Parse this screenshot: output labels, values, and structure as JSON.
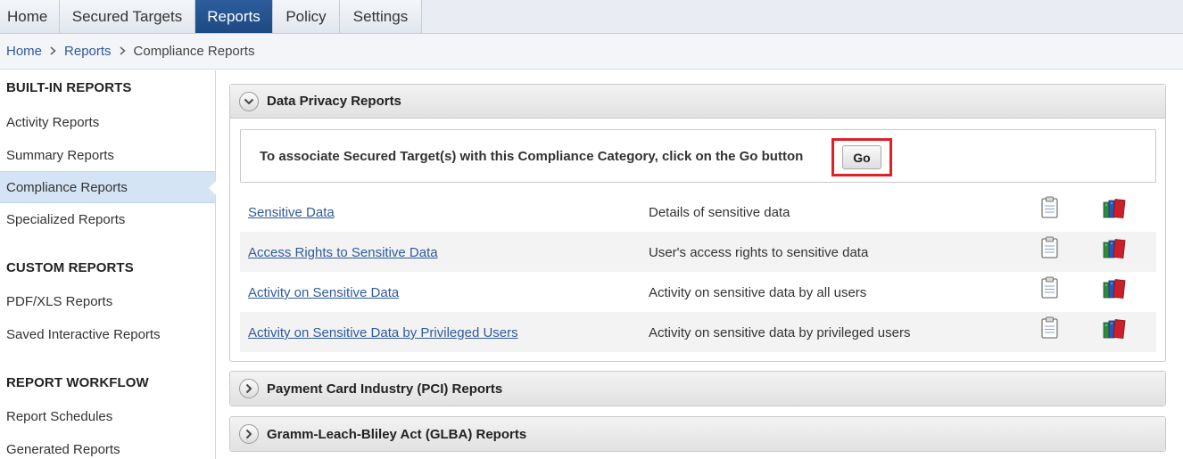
{
  "topnav": {
    "tabs": [
      {
        "label": "Home"
      },
      {
        "label": "Secured Targets"
      },
      {
        "label": "Reports"
      },
      {
        "label": "Policy"
      },
      {
        "label": "Settings"
      }
    ],
    "active_tab": "Reports"
  },
  "breadcrumb": {
    "items": [
      "Home",
      "Reports"
    ],
    "current": "Compliance Reports"
  },
  "sidebar": {
    "sections": [
      {
        "heading": "BUILT-IN REPORTS",
        "items": [
          "Activity Reports",
          "Summary Reports",
          "Compliance Reports",
          "Specialized Reports"
        ]
      },
      {
        "heading": "CUSTOM REPORTS",
        "items": [
          "PDF/XLS Reports",
          "Saved Interactive Reports"
        ]
      },
      {
        "heading": "REPORT WORKFLOW",
        "items": [
          "Report Schedules",
          "Generated Reports"
        ]
      }
    ],
    "active_item": "Compliance Reports"
  },
  "panels": [
    {
      "title": "Data Privacy Reports",
      "expanded": true,
      "assoc_text": "To associate Secured Target(s) with this Compliance Category, click on the Go button",
      "go_label": "Go",
      "reports": [
        {
          "name": "Sensitive Data",
          "desc": "Details of sensitive data"
        },
        {
          "name": "Access Rights to Sensitive Data",
          "desc": "User's access rights to sensitive data"
        },
        {
          "name": "Activity on Sensitive Data",
          "desc": "Activity on sensitive data by all users"
        },
        {
          "name": "Activity on Sensitive Data by Privileged Users",
          "desc": "Activity on sensitive data by privileged users"
        }
      ]
    },
    {
      "title": "Payment Card Industry (PCI) Reports",
      "expanded": false
    },
    {
      "title": "Gramm-Leach-Bliley Act (GLBA) Reports",
      "expanded": false
    }
  ],
  "icons": {
    "report_icon": "clipboard-icon",
    "pdf_icon": "books-icon"
  },
  "colors": {
    "nav_active": "#1e4a82",
    "link": "#2f5a9c",
    "highlight_box": "#e01f26",
    "sidebar_active": "#d5e4f5"
  }
}
